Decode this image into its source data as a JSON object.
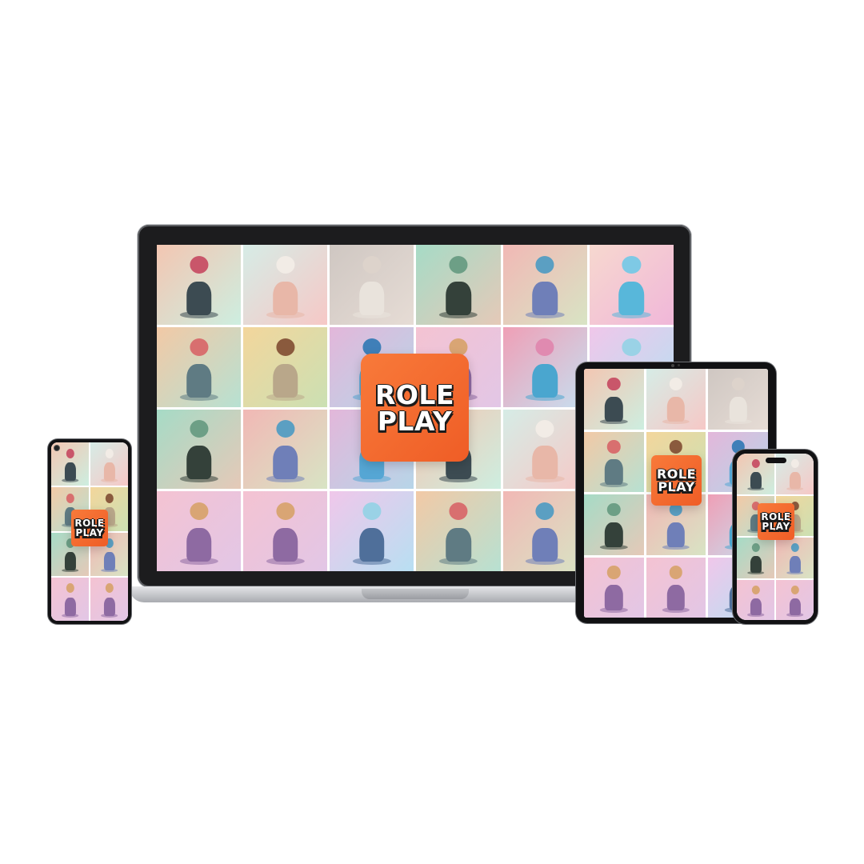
{
  "brand": {
    "line1": "ROLE",
    "line2": "PLAY",
    "color": "#f26a2e"
  },
  "devices": [
    "laptop",
    "tablet",
    "phone-right",
    "phone-left"
  ],
  "tile_palettes": [
    {
      "bg": [
        "#f3c6b2",
        "#cdeee0"
      ],
      "fig": "#3c4b52",
      "head": "#c9566a"
    },
    {
      "bg": [
        "#d6ece6",
        "#f6c8c6"
      ],
      "fig": "#e8b7a8",
      "head": "#f2ece6"
    },
    {
      "bg": [
        "#cfc7c2",
        "#e6dcd5"
      ],
      "fig": "#e9e3dc",
      "head": "#ddd3cb"
    },
    {
      "bg": [
        "#a6dbc6",
        "#e5c9b8"
      ],
      "fig": "#34413a",
      "head": "#6d9f86"
    },
    {
      "bg": [
        "#f1b8b5",
        "#d8e4c4"
      ],
      "fig": "#6f7fb8",
      "head": "#5b9fc2"
    },
    {
      "bg": [
        "#f7d8cf",
        "#f0b7d9"
      ],
      "fig": "#58b7da",
      "head": "#7ec9e5"
    },
    {
      "bg": [
        "#f2c9a6",
        "#b7e1d2"
      ],
      "fig": "#5f7b83",
      "head": "#d86f6f"
    },
    {
      "bg": [
        "#f3d69c",
        "#cbe0b3"
      ],
      "fig": "#b9a78a",
      "head": "#8a5a3d"
    },
    {
      "bg": [
        "#e3b7da",
        "#b7d5e8"
      ],
      "fig": "#55a6d4",
      "head": "#3f7fb8"
    },
    {
      "bg": [
        "#f4c3d2",
        "#e2c6e6"
      ],
      "fig": "#8e6aa2",
      "head": "#d9a574"
    },
    {
      "bg": [
        "#ef9fb6",
        "#c6dff0"
      ],
      "fig": "#4aa6cf",
      "head": "#e08ab0"
    },
    {
      "bg": [
        "#f0c7ea",
        "#b8dff2"
      ],
      "fig": "#4f6f9a",
      "head": "#9ad2e6"
    }
  ],
  "tile_sequence": {
    "laptop": [
      0,
      1,
      2,
      3,
      4,
      5,
      6,
      7,
      8,
      9,
      10,
      11,
      3,
      4,
      8,
      0,
      1,
      10,
      9,
      9,
      11,
      6,
      4,
      5
    ],
    "tablet": [
      0,
      1,
      2,
      6,
      7,
      8,
      3,
      4,
      10,
      9,
      9,
      11
    ],
    "phone-right": [
      0,
      1,
      6,
      7,
      3,
      4,
      9,
      9
    ],
    "phone-left": [
      0,
      1,
      6,
      7,
      3,
      4,
      9,
      9
    ]
  }
}
